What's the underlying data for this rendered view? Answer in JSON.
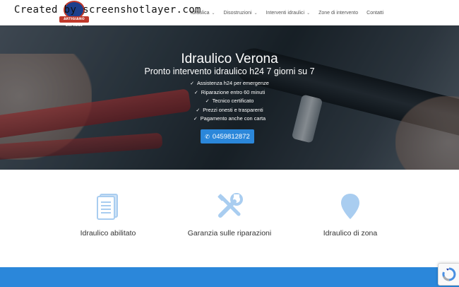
{
  "watermark": "Created by screenshotlayer.com",
  "logo": {
    "banner_text": "ARTIGIANO EXPRESS"
  },
  "nav": {
    "items": [
      {
        "label": "Idraulica",
        "has_dropdown": true
      },
      {
        "label": "Disostruzioni",
        "has_dropdown": true
      },
      {
        "label": "Interventi idraulici",
        "has_dropdown": true
      },
      {
        "label": "Zone di intervento",
        "has_dropdown": false
      },
      {
        "label": "Contatti",
        "has_dropdown": false
      }
    ]
  },
  "hero": {
    "title": "Idraulico Verona",
    "subtitle": "Pronto intervento idraulico h24 7 giorni su 7",
    "features": [
      "Assistenza h24 per emergenze",
      "Riparazione entro 60 minuti",
      "Tecnico certificato",
      "Prezzi onesti e trasparenti",
      "Pagamento anche con carta"
    ],
    "phone": "0459812872"
  },
  "services": [
    {
      "label": "Idraulico abilitato",
      "icon": "document-icon"
    },
    {
      "label": "Garanzia sulle riparazioni",
      "icon": "tools-icon"
    },
    {
      "label": "Idraulico di zona",
      "icon": "map-pin-icon"
    }
  ],
  "colors": {
    "accent": "#2b87da",
    "icon_light": "#a9cdf0",
    "nav_text": "#555555"
  }
}
